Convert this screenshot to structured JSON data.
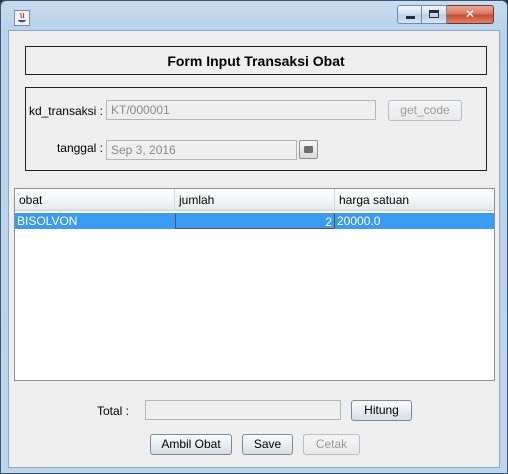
{
  "window": {
    "icon": "java-icon",
    "controls": {
      "minimize": "minimize-icon",
      "maximize": "maximize-icon",
      "close": "close-icon"
    }
  },
  "header": {
    "title": "Form Input Transaksi Obat"
  },
  "form": {
    "kd_transaksi_label": "kd_transaksi :",
    "kd_transaksi_value": "KT/000001",
    "get_code_label": "get_code",
    "tanggal_label": "tanggal :",
    "tanggal_value": "Sep 3, 2016"
  },
  "table": {
    "columns": [
      "obat",
      "jumlah",
      "harga satuan"
    ],
    "rows": [
      {
        "obat": "BISOLVON",
        "jumlah": "2",
        "harga_satuan": "20000.0"
      }
    ]
  },
  "footer": {
    "total_label": "Total :",
    "total_value": "",
    "hitung_label": "Hitung",
    "ambil_obat_label": "Ambil Obat",
    "save_label": "Save",
    "cetak_label": "Cetak"
  },
  "colors": {
    "selection": "#3a9bf0",
    "titlebar": "#b9d1ea",
    "panel": "#eeeeee"
  }
}
